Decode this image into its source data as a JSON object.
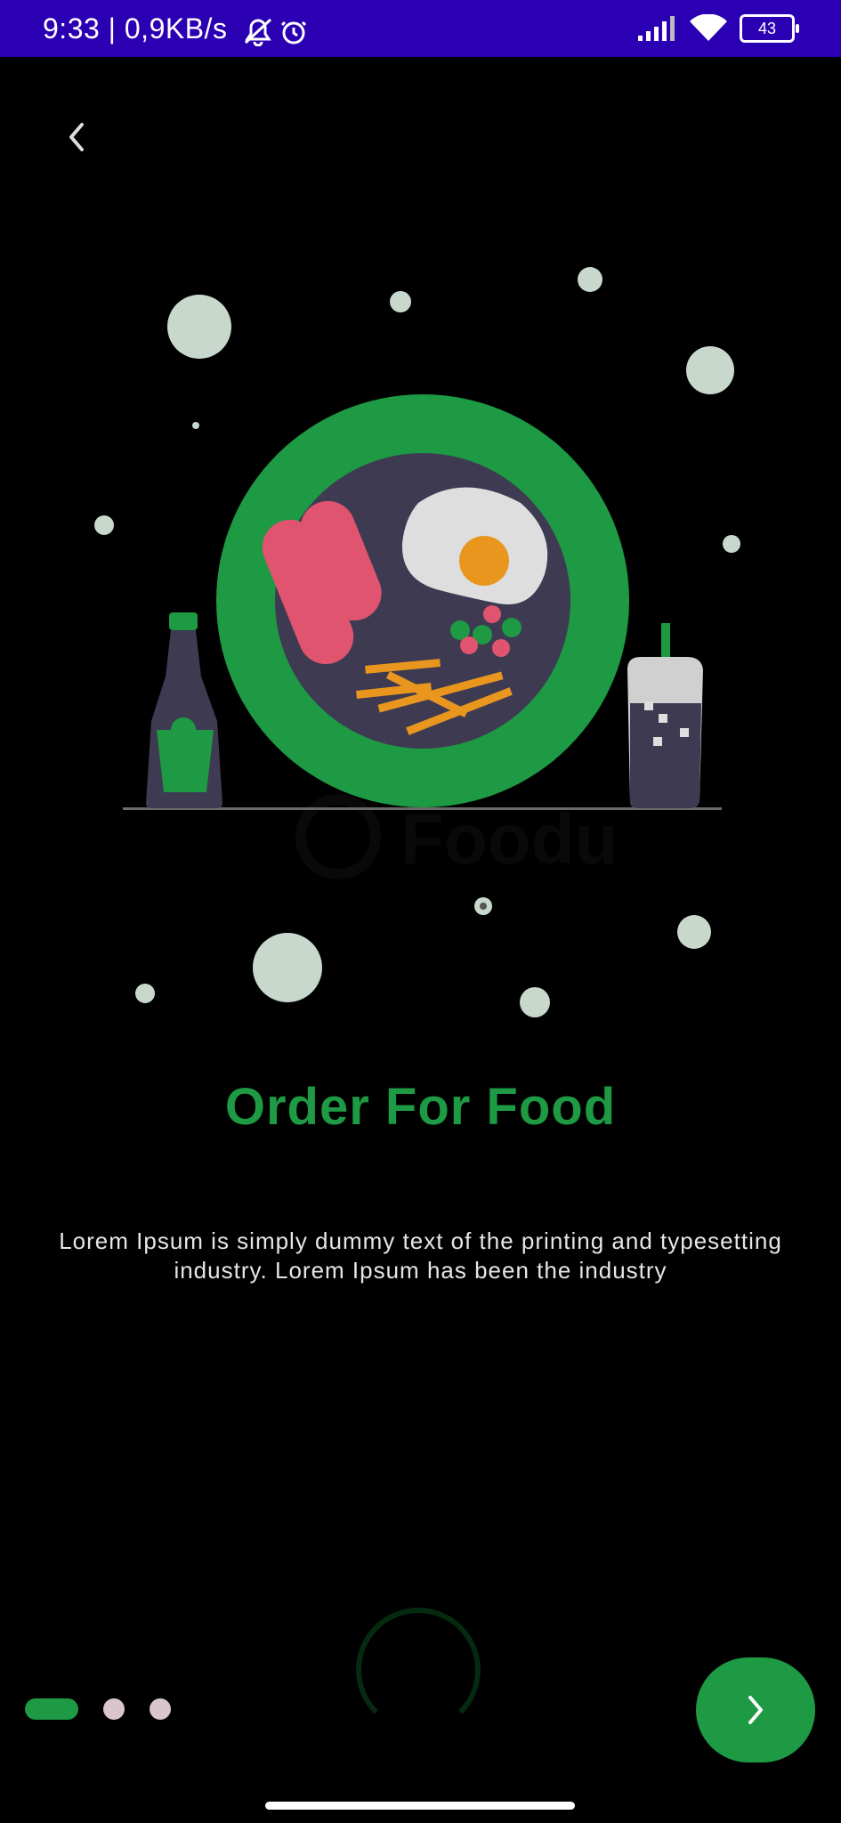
{
  "status_bar": {
    "time": "9:33 | 0,9KB/s",
    "battery": "43",
    "icons": [
      "mute-icon",
      "alarm-icon",
      "signal-icon",
      "wifi-icon",
      "battery-icon"
    ]
  },
  "nav": {
    "back_icon": "chevron-left-icon"
  },
  "illustration": {
    "watermark": "Foodu"
  },
  "onboarding": {
    "title": "Order For Food",
    "description": "Lorem Ipsum is simply dummy text of the printing and typesetting industry. Lorem Ipsum has been the industry"
  },
  "pager": {
    "pages": 3,
    "current": 1
  },
  "next_button": {
    "icon": "chevron-right-icon"
  },
  "colors": {
    "accent": "#1e9944",
    "background": "#000000",
    "status_bar": "#2b00b3",
    "text": "#e6e6e6",
    "inactive_dot": "#d8c5cd"
  }
}
